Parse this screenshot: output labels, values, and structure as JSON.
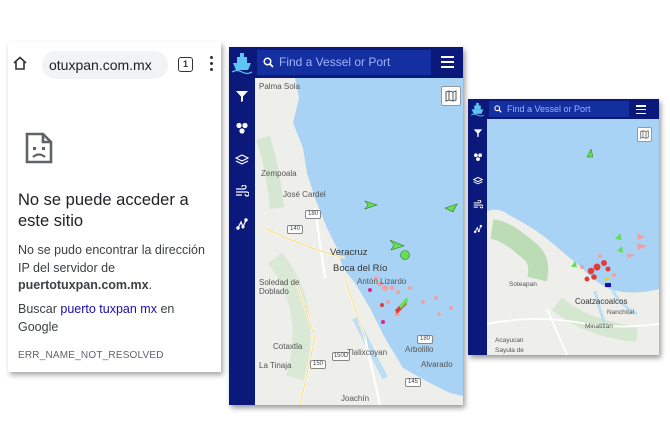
{
  "browser": {
    "url": "otuxpan.com.mx",
    "tab_count": "1",
    "error_title": "No se puede acceder a este sitio",
    "error_desc_prefix": "No se pudo encontrar la dirección IP del servidor de",
    "error_host": "puertotuxpan.com.mx",
    "error_desc_suffix": ".",
    "search_prefix": "Buscar",
    "search_link": "puerto tuxpan mx",
    "search_suffix": "en Google",
    "error_code": "ERR_NAME_NOT_RESOLVED"
  },
  "map1": {
    "search_placeholder": "Find a Vessel or Port",
    "places": {
      "palma_sola": "Palma Sola",
      "zempoala": "Zempoala",
      "jose_cardel": "José Cardel",
      "veracruz": "Veracruz",
      "boca_del_rio": "Boca del Río",
      "anton_lizardo": "Antón Lizardo",
      "soledad": "Soledad de Doblado",
      "cotaxtla": "Cotaxtla",
      "la_tinaja": "La Tinaja",
      "tlalixcoyan": "Tlalixcoyan",
      "arbolillo": "Arbolillo",
      "alvarado": "Alvarado",
      "joachin": "Joachín"
    },
    "roads": {
      "r180a": "180",
      "r140": "140",
      "r150d": "150D",
      "r150": "150",
      "r180b": "180",
      "r145": "145"
    }
  },
  "map2": {
    "search_placeholder": "Find a Vessel or Port",
    "places": {
      "coatzacoalcos": "Coatzacoalcos",
      "sotepan": "Soteapan",
      "acayucan": "Acayucan",
      "minatitlan": "Minatitlán",
      "nanchital": "Nanchital",
      "sayula": "Sayula de"
    }
  },
  "colors": {
    "app_navy": "#0b1a7a",
    "search_blue": "#142fa0",
    "sea": "#a9d3f5",
    "land": "#eeeeea",
    "link": "#1a0dab"
  }
}
